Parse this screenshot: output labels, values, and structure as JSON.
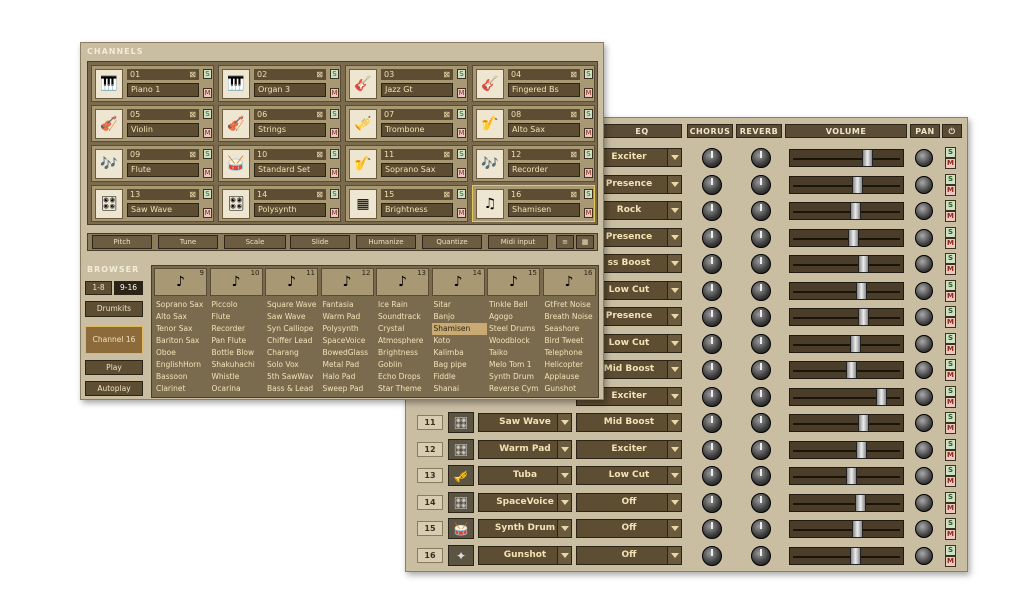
{
  "channels_title": "CHANNELS",
  "channels": [
    {
      "num": "01",
      "name": "Piano 1",
      "icon": "piano-icon"
    },
    {
      "num": "02",
      "name": "Organ 3",
      "icon": "organ-icon"
    },
    {
      "num": "03",
      "name": "Jazz Gt",
      "icon": "guitar-icon"
    },
    {
      "num": "04",
      "name": "Fingered Bs",
      "icon": "bass-icon"
    },
    {
      "num": "05",
      "name": "Violin",
      "icon": "violin-icon"
    },
    {
      "num": "06",
      "name": "Strings",
      "icon": "strings-icon"
    },
    {
      "num": "07",
      "name": "Trombone",
      "icon": "trombone-icon"
    },
    {
      "num": "08",
      "name": "Alto Sax",
      "icon": "sax-icon"
    },
    {
      "num": "09",
      "name": "Flute",
      "icon": "flute-icon"
    },
    {
      "num": "10",
      "name": "Standard Set",
      "icon": "drum-icon"
    },
    {
      "num": "11",
      "name": "Soprano Sax",
      "icon": "sax-icon"
    },
    {
      "num": "12",
      "name": "Recorder",
      "icon": "recorder-icon"
    },
    {
      "num": "13",
      "name": "Saw Wave",
      "icon": "synth-icon"
    },
    {
      "num": "14",
      "name": "Polysynth",
      "icon": "synth-icon"
    },
    {
      "num": "15",
      "name": "Brightness",
      "icon": "pad-icon"
    },
    {
      "num": "16",
      "name": "Shamisen",
      "icon": "shamisen-icon"
    }
  ],
  "toolbar": [
    "Pitch",
    "Tune",
    "Scale",
    "Slide",
    "Humanize",
    "Quantize",
    "Midi input"
  ],
  "browser": {
    "title": "BROWSER",
    "range_a": "1-8",
    "range_b": "9-16",
    "drumkits": "Drumkits",
    "channel": "Channel 16",
    "play": "Play",
    "autoplay": "Autoplay",
    "col_nums": [
      "9",
      "10",
      "11",
      "12",
      "13",
      "14",
      "15",
      "16"
    ],
    "columns": [
      [
        "Soprano Sax",
        "Alto Sax",
        "Tenor Sax",
        "Bariton Sax",
        "Oboe",
        "EnglishHorn",
        "Bassoon",
        "Clarinet"
      ],
      [
        "Piccolo",
        "Flute",
        "Recorder",
        "Pan Flute",
        "Bottle Blow",
        "Shakuhachi",
        "Whistle",
        "Ocarina"
      ],
      [
        "Square Wave",
        "Saw Wave",
        "Syn Calliope",
        "Chiffer Lead",
        "Charang",
        "Solo Vox",
        "5th SawWav",
        "Bass & Lead"
      ],
      [
        "Fantasia",
        "Warm Pad",
        "Polysynth",
        "SpaceVoice",
        "BowedGlass",
        "Metal Pad",
        "Halo Pad",
        "Sweep Pad"
      ],
      [
        "Ice Rain",
        "Soundtrack",
        "Crystal",
        "Atmosphere",
        "Brightness",
        "Goblin",
        "Echo Drops",
        "Star Theme"
      ],
      [
        "Sitar",
        "Banjo",
        "Shamisen",
        "Koto",
        "Kalimba",
        "Bag pipe",
        "Fiddle",
        "Shanai"
      ],
      [
        "Tinkle Bell",
        "Agogo",
        "Steel Drums",
        "Woodblock",
        "Taiko",
        "Melo Tom 1",
        "Synth Drum",
        "Reverse Cym"
      ],
      [
        "GtFret Noise",
        "Breath Noise",
        "Seashore",
        "Bird Tweet",
        "Telephone",
        "Helicopter",
        "Applause",
        "Gunshot"
      ]
    ]
  },
  "mixer": {
    "headers": {
      "eq": "EQ",
      "chorus": "CHORUS",
      "reverb": "REVERB",
      "volume": "VOLUME",
      "pan": "PAN"
    },
    "rows": [
      {
        "num": "",
        "inst": "",
        "eq": "Exciter",
        "vol": 0.72
      },
      {
        "num": "",
        "inst": "",
        "eq": "Presence",
        "vol": 0.62
      },
      {
        "num": "",
        "inst": "",
        "eq": "Rock",
        "vol": 0.6
      },
      {
        "num": "",
        "inst": "",
        "eq": "Presence",
        "vol": 0.58
      },
      {
        "num": "",
        "inst": "",
        "eq": "ss Boost",
        "vol": 0.68
      },
      {
        "num": "",
        "inst": "",
        "eq": "Low Cut",
        "vol": 0.66
      },
      {
        "num": "",
        "inst": "",
        "eq": "Presence",
        "vol": 0.68
      },
      {
        "num": "",
        "inst": "",
        "eq": "Low Cut",
        "vol": 0.6
      },
      {
        "num": "",
        "inst": "",
        "eq": "Mid Boost",
        "vol": 0.56
      },
      {
        "num": "",
        "inst": "",
        "eq": "Exciter",
        "vol": 0.86
      },
      {
        "num": "11",
        "inst": "Saw Wave",
        "eq": "Mid Boost",
        "vol": 0.68,
        "icon": "synth-icon"
      },
      {
        "num": "12",
        "inst": "Warm Pad",
        "eq": "Exciter",
        "vol": 0.66,
        "icon": "synth-icon"
      },
      {
        "num": "13",
        "inst": "Tuba",
        "eq": "Low Cut",
        "vol": 0.56,
        "icon": "tuba-icon"
      },
      {
        "num": "14",
        "inst": "SpaceVoice",
        "eq": "Off",
        "vol": 0.65,
        "icon": "synth-icon"
      },
      {
        "num": "15",
        "inst": "Synth Drum",
        "eq": "Off",
        "vol": 0.62,
        "icon": "drum-icon"
      },
      {
        "num": "16",
        "inst": "Gunshot",
        "eq": "Off",
        "vol": 0.6,
        "icon": "gun-icon"
      }
    ]
  }
}
